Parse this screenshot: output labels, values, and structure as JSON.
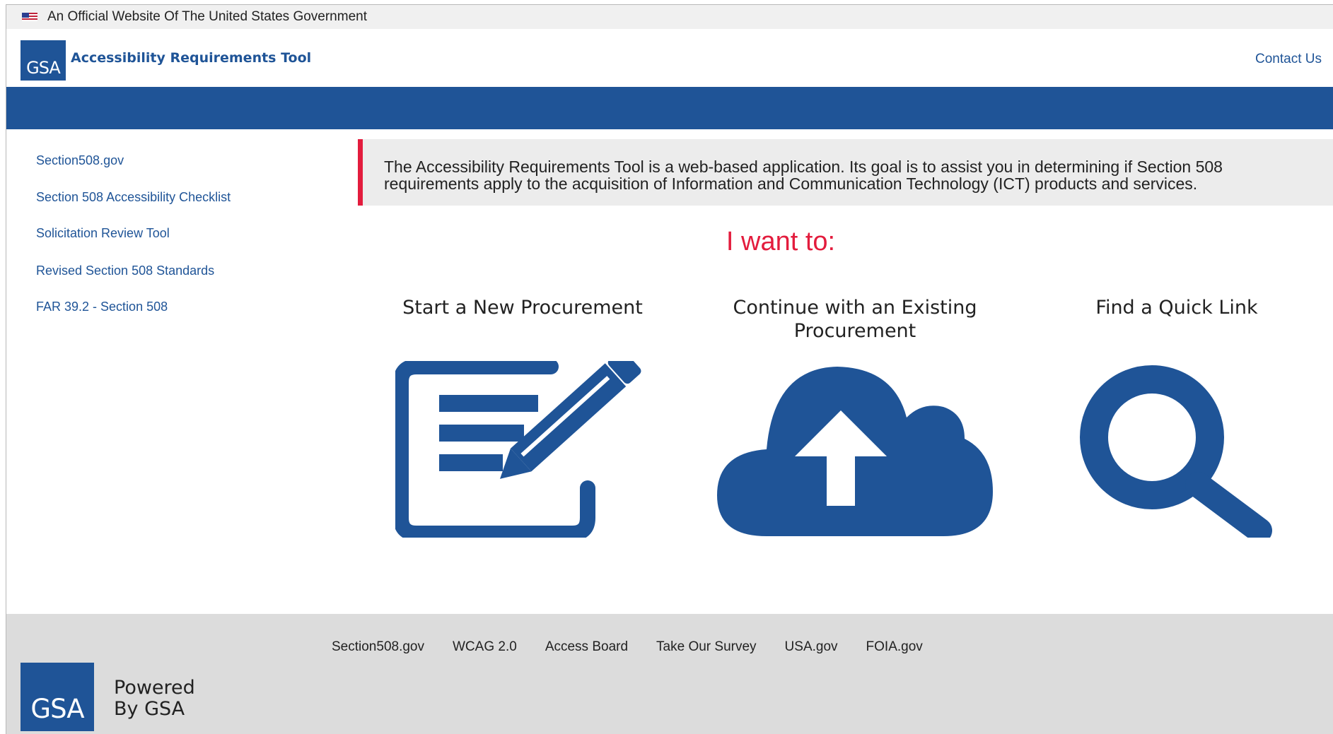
{
  "gov_banner": {
    "text": "An Official Website Of The United States Government",
    "flag_icon": "us-flag-icon"
  },
  "header": {
    "logo_text": "GSA",
    "app_title": "Accessibility Requirements Tool",
    "contact_label": "Contact Us"
  },
  "sidebar": {
    "items": [
      {
        "label": "Section508.gov"
      },
      {
        "label": "Section 508 Accessibility Checklist"
      },
      {
        "label": "Solicitation Review Tool"
      },
      {
        "label": "Revised Section 508 Standards"
      },
      {
        "label": "FAR 39.2 - Section 508"
      }
    ]
  },
  "intro": {
    "text": "The Accessibility Requirements Tool is a web-based application. Its goal is to assist you in determining if Section 508 requirements apply to the acquisition of Information and Communication Technology (ICT) products and services."
  },
  "main": {
    "heading": "I want to:",
    "options": [
      {
        "label": "Start a New Procurement",
        "icon": "document-edit-icon"
      },
      {
        "label": "Continue with an Existing Procurement",
        "icon": "cloud-upload-icon"
      },
      {
        "label": "Find a Quick Link",
        "icon": "search-icon"
      }
    ]
  },
  "footer": {
    "links": [
      {
        "label": "Section508.gov"
      },
      {
        "label": "WCAG 2.0"
      },
      {
        "label": "Access Board"
      },
      {
        "label": "Take Our Survey"
      },
      {
        "label": "USA.gov"
      },
      {
        "label": "FOIA.gov"
      }
    ],
    "logo_text": "GSA",
    "powered_line1": "Powered",
    "powered_line2": "By GSA"
  },
  "colors": {
    "brand_blue": "#1f5497",
    "accent_red": "#e31c3d",
    "footer_gray": "#dcdcdc",
    "intro_gray": "#ececec"
  }
}
